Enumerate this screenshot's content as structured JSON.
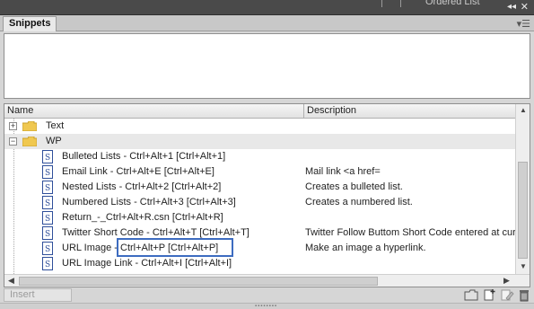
{
  "background_panel": {
    "ghost_label": "Ordered List"
  },
  "panel": {
    "tab_label": "Snippets",
    "collapse_icon": "double-chevron",
    "close_icon": "close",
    "menu_icon": "panel-menu"
  },
  "columns": {
    "name": "Name",
    "description": "Description"
  },
  "rows": [
    {
      "type": "folder",
      "expander": "+",
      "name": "Text",
      "description": ""
    },
    {
      "type": "folder",
      "expander": "−",
      "name": "WP",
      "description": "",
      "selected": true
    },
    {
      "type": "snippet",
      "name": "Bulleted Lists - Ctrl+Alt+1 [Ctrl+Alt+1]",
      "description": ""
    },
    {
      "type": "snippet",
      "name": "Email Link - Ctrl+Alt+E [Ctrl+Alt+E]",
      "description": "Mail link <a href="
    },
    {
      "type": "snippet",
      "name": "Nested Lists - Ctrl+Alt+2 [Ctrl+Alt+2]",
      "description": "Creates a bulleted list."
    },
    {
      "type": "snippet",
      "name": "Numbered Lists - Ctrl+Alt+3 [Ctrl+Alt+3]",
      "description": "Creates a numbered list."
    },
    {
      "type": "snippet",
      "name": "Return_-_Ctrl+Alt+R.csn [Ctrl+Alt+R]",
      "description": ""
    },
    {
      "type": "snippet",
      "name": "Twitter Short Code - Ctrl+Alt+T [Ctrl+Alt+T]",
      "description": "Twitter Follow Buttom Short Code entered at cur"
    },
    {
      "type": "snippet",
      "name": "URL Image - Ctrl+Alt+P [Ctrl+Alt+P]",
      "description": "Make an image a hyperlink."
    },
    {
      "type": "snippet",
      "name": "URL Image Link - Ctrl+Alt+I  [Ctrl+Alt+I]",
      "description": ""
    }
  ],
  "toolbar": {
    "insert_label": "Insert"
  },
  "colors": {
    "highlight_border": "#3d6cc0",
    "selected_row": "#e8e8e8",
    "snippet_icon": "#2f4f9a",
    "folder": "#f0c850"
  }
}
